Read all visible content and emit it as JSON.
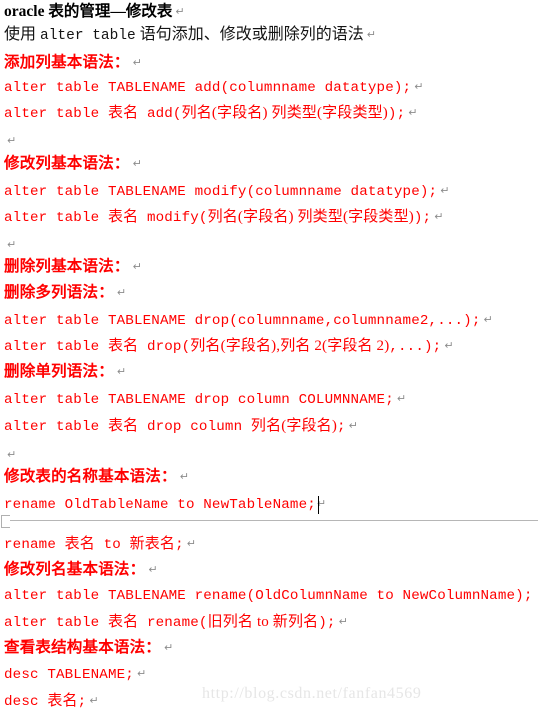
{
  "document": {
    "title": "oracle 表的管理—修改表",
    "return_mark": "↵",
    "background_color": "#ffffff",
    "code_color": "#ff0000",
    "heading_color": "#ff0000",
    "title_color": "#000000",
    "body_color": "#141414",
    "mark_color": "#8c8c8c",
    "watermark_color": "#e6e6e6"
  },
  "watermark": {
    "text": "http://blog.csdn.net/fanfan4569"
  },
  "lines": {
    "l01_title": "oracle 表的管理—修改表",
    "l02_intro_a": "使用 ",
    "l02_intro_mono": "alter table",
    "l02_intro_b": " 语句添加、修改或删除列的语法",
    "l03_head_add": "添加列基本语法：",
    "l04_code": "alter table TABLENAME add(columnname datatype);",
    "l05_code_en": "alter table ",
    "l05_code_cjk": "表名",
    "l05_code_mid": " add(",
    "l05_code_cjk2": "列名(字段名) 列类型(字段类型)",
    "l05_code_end": ");",
    "l07_head_modify": "修改列基本语法：",
    "l08_code": "alter table TABLENAME modify(columnname datatype);",
    "l09_code_en": "alter table ",
    "l09_code_cjk": "表名",
    "l09_code_mid": " modify(",
    "l09_code_cjk2": "列名(字段名) 列类型(字段类型)",
    "l09_code_end": ");",
    "l11_head_drop": "删除列基本语法：",
    "l12_head_drop_multi": "删除多列语法：",
    "l13_code": "alter table TABLENAME drop(columnname,columnname2,...);",
    "l14_code_en": "alter table ",
    "l14_code_cjk": "表名",
    "l14_code_mid": " drop(",
    "l14_code_cjk2": "列名(字段名),列名 2(字段名 2)",
    "l14_code_end": ",...);",
    "l15_head_drop_single": "删除单列语法：",
    "l16_code": "alter table TABLENAME drop column COLUMNNAME;",
    "l17_code_en": "alter table ",
    "l17_code_cjk": "表名",
    "l17_code_mid": " drop column ",
    "l17_code_cjk2": "列名(字段名)",
    "l17_code_end": ";",
    "l19_head_rename_table": "修改表的名称基本语法：",
    "l20_code": "rename OldTableName to NewTableName;",
    "l21_code_en": "rename ",
    "l21_code_cjk": "表名",
    "l21_code_mid": " to ",
    "l21_code_cjk2": "新表名",
    "l21_code_end": ";",
    "l22_head_rename_col": "修改列名基本语法：",
    "l23_code": "alter table TABLENAME rename(OldColumnName to NewColumnName);",
    "l24_code_en": "alter table ",
    "l24_code_cjk": "表名",
    "l24_code_mid": " rename(",
    "l24_code_cjk2": "旧列名 to 新列名",
    "l24_code_end": ");",
    "l25_head_desc": "查看表结构基本语法：",
    "l26_code": "desc TABLENAME;",
    "l27_code_en": "desc ",
    "l27_code_cjk": "表名",
    "l27_code_end": ";"
  }
}
